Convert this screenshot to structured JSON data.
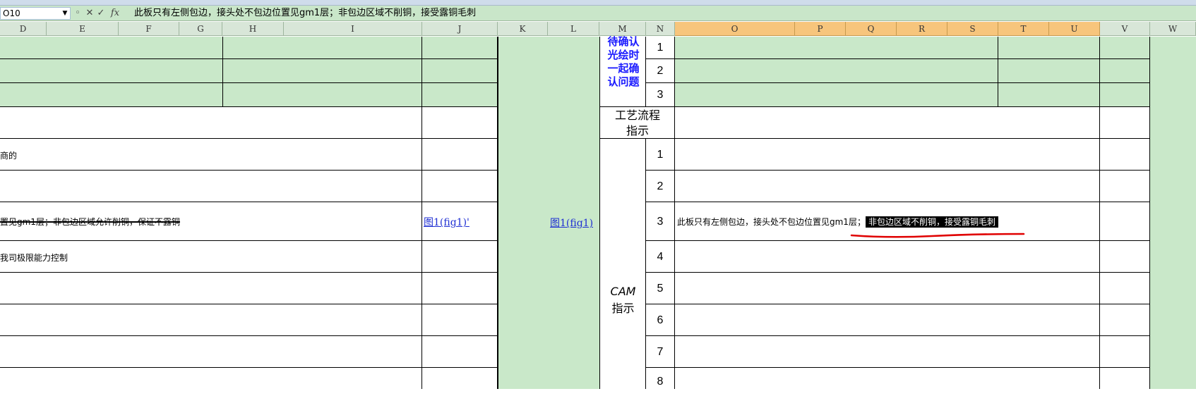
{
  "formula_bar": {
    "name_box": "O10",
    "function_icon": "fx",
    "content": "此板只有左侧包边，接头处不包边位置见gm1层；非包边区域不削铜，接受露铜毛刺"
  },
  "columns": [
    "D",
    "E",
    "F",
    "G",
    "H",
    "I",
    "J",
    "K",
    "L",
    "M",
    "N",
    "O",
    "P",
    "Q",
    "R",
    "S",
    "T",
    "U",
    "V",
    "W"
  ],
  "selected_column": "O",
  "left_cells": {
    "row5_text": "商的",
    "row7_text": "置见gm1层；非包边区域允许削铜，保证不露铜",
    "row8_text": "我司极限能力控制",
    "link_j": "图1(fig1)'",
    "link_l": "图1(fig1)"
  },
  "section_labels": {
    "confirm": "待确认光绘时一起确认问题",
    "process_1": "工艺流程",
    "process_2": "指示",
    "cam_1": "CAM",
    "cam_2": "指示"
  },
  "row_numbers": {
    "confirm": [
      "1",
      "2",
      "3"
    ],
    "cam": [
      "1",
      "2",
      "3",
      "4",
      "5",
      "6",
      "7",
      "8"
    ]
  },
  "cam_row3": {
    "normal_text": "此板只有左侧包边，接头处不包边位置见gm1层；",
    "highlighted_text": "非包边区域不削铜，接受露铜毛刺"
  },
  "colors": {
    "sheet_green": "#c9e8c9",
    "header_selected": "#f7c57c",
    "label_blue": "#1a1aff",
    "annotation_red": "#e00000",
    "link_blue": "#1f2fd3"
  }
}
